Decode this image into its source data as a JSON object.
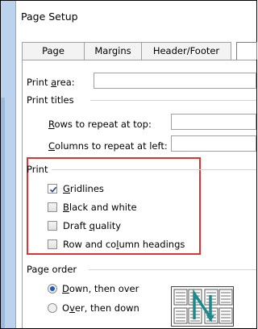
{
  "window": {
    "title": "Page Setup"
  },
  "tabs": [
    {
      "label": "Page"
    },
    {
      "label": "Margins"
    },
    {
      "label": "Header/Footer"
    }
  ],
  "print_area": {
    "label_pre": "Print ",
    "label_ul": "a",
    "label_post": "rea:",
    "value": ""
  },
  "print_titles": {
    "heading": "Print titles",
    "rows": {
      "label_ul": "R",
      "label_post": "ows to repeat at top:",
      "value": ""
    },
    "columns": {
      "label_ul": "C",
      "label_post": "olumns to repeat at left:",
      "value": ""
    }
  },
  "print_section": {
    "heading": "Print",
    "options": [
      {
        "pre": "",
        "ul": "G",
        "post": "ridlines",
        "checked": true
      },
      {
        "pre": "",
        "ul": "B",
        "post": "lack and white",
        "checked": false
      },
      {
        "pre": "Draft ",
        "ul": "q",
        "post": "uality",
        "checked": false
      },
      {
        "pre": "Row and co",
        "ul": "l",
        "post": "umn headings",
        "checked": false
      }
    ]
  },
  "page_order": {
    "heading": "Page order",
    "options": [
      {
        "pre": "",
        "ul": "D",
        "post": "own, then over",
        "selected": true
      },
      {
        "pre": "O",
        "ul": "v",
        "post": "er, then down",
        "selected": false
      }
    ]
  },
  "colors": {
    "highlight": "#e0322f",
    "accent": "#1e5bb8",
    "diagram_arrow": "#1a8a8c"
  }
}
